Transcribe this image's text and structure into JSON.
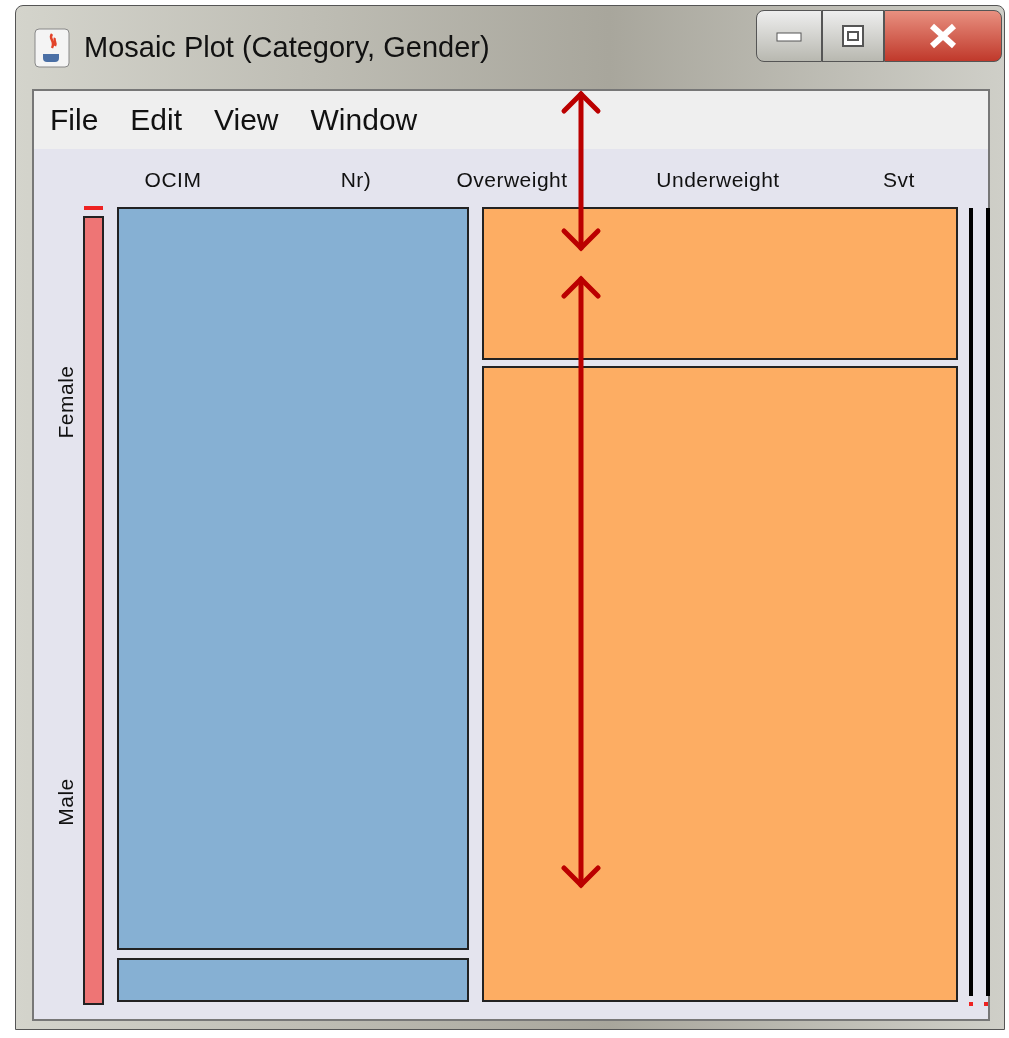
{
  "window": {
    "title": "Mosaic Plot (Category, Gender)"
  },
  "menu": [
    "File",
    "Edit",
    "View",
    "Window"
  ],
  "plot": {
    "column_labels": [
      "OCIM",
      "Nr)",
      "Overweight",
      "Underweight",
      "Svt"
    ],
    "row_labels": [
      "Female",
      "Male"
    ]
  }
}
